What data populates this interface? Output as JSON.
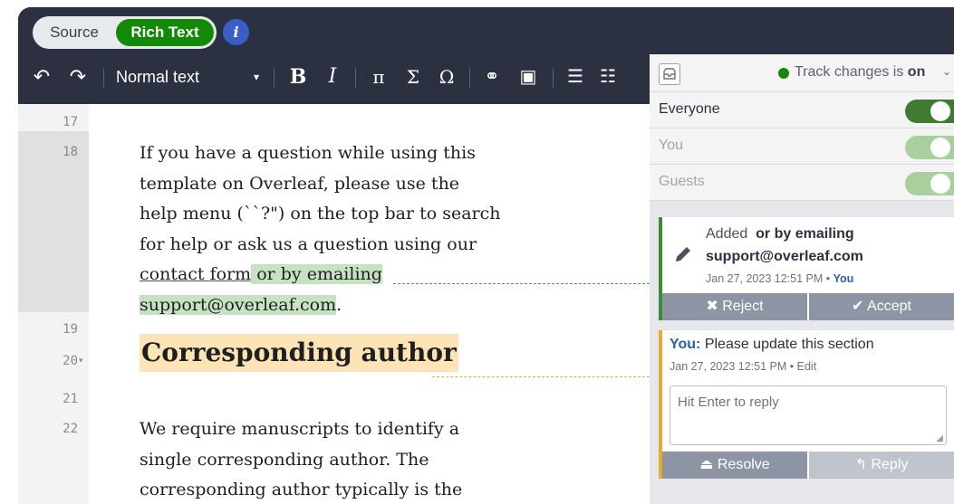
{
  "modes": {
    "source": "Source",
    "rich_text": "Rich Text",
    "info": "i"
  },
  "toolbar": {
    "undo": "↶",
    "redo": "↷",
    "style": "Normal text",
    "style_caret": "▾",
    "bold": "B",
    "italic": "I",
    "pi": "π",
    "sigma": "Σ",
    "omega": "Ω",
    "link": "⚭",
    "image": "▣",
    "bullet_list": "☰",
    "numbered_list": "☷"
  },
  "lines": [
    {
      "number": "17"
    },
    {
      "number": "18"
    },
    {
      "number": "19"
    },
    {
      "number": "20",
      "fold": "▾"
    },
    {
      "number": "21"
    },
    {
      "number": "22"
    }
  ],
  "content": {
    "para1": {
      "l1": "If you have a question while using this",
      "l2": "template on Overleaf, please use the",
      "l3": "help menu (``?\") on the top bar to search",
      "l4": "for help or ask us a question using our",
      "link": "contact form",
      "added_1": " or by emailing ",
      "added_2": "support@overleaf.com",
      "end": "."
    },
    "heading": "Corresponding author",
    "para2": {
      "l1": "We require manuscripts to identify a",
      "l2": "single corresponding author. The",
      "l3": "corresponding author typically is the"
    }
  },
  "review": {
    "track_changes_prefix": "Track changes is ",
    "track_changes_state": "on",
    "caret": "⌄",
    "rows": [
      {
        "label": "Everyone",
        "on": true
      },
      {
        "label": "You",
        "on": true
      },
      {
        "label": "Guests",
        "on": true
      }
    ],
    "colors": {
      "toggle_active": "#3f7b33",
      "toggle_muted": "#a9cf9f"
    },
    "change": {
      "action": "Added",
      "text_1": "or by emailing",
      "text_2": "support@overleaf.com",
      "date": "Jan 27, 2023 12:51 PM",
      "separator": "•",
      "author": "You",
      "reject": "✖ Reject",
      "accept": "✔ Accept"
    },
    "comment": {
      "author": "You:",
      "text": "Please update this section",
      "date": "Jan 27, 2023 12:51 PM",
      "separator": "•",
      "edit": "Edit",
      "reply_placeholder": "Hit Enter to reply",
      "resolve": "⏏ Resolve",
      "reply": "↰ Reply"
    }
  }
}
